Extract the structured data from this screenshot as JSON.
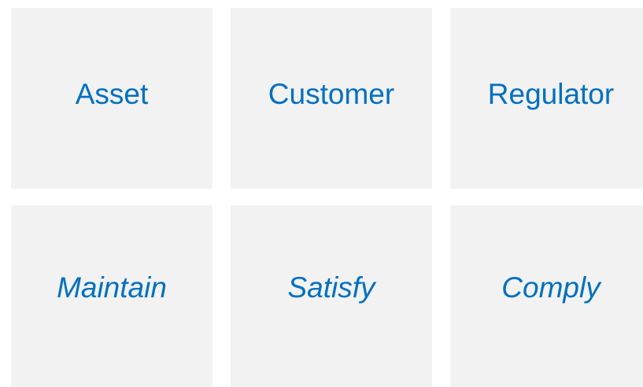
{
  "colors": {
    "tile_background": "#f2f2f2",
    "text_accent": "#0070c0"
  },
  "top_row": [
    {
      "label": "Asset"
    },
    {
      "label": "Customer"
    },
    {
      "label": "Regulator"
    }
  ],
  "bottom_row": [
    {
      "label": "Maintain"
    },
    {
      "label": "Satisfy"
    },
    {
      "label": "Comply"
    }
  ]
}
